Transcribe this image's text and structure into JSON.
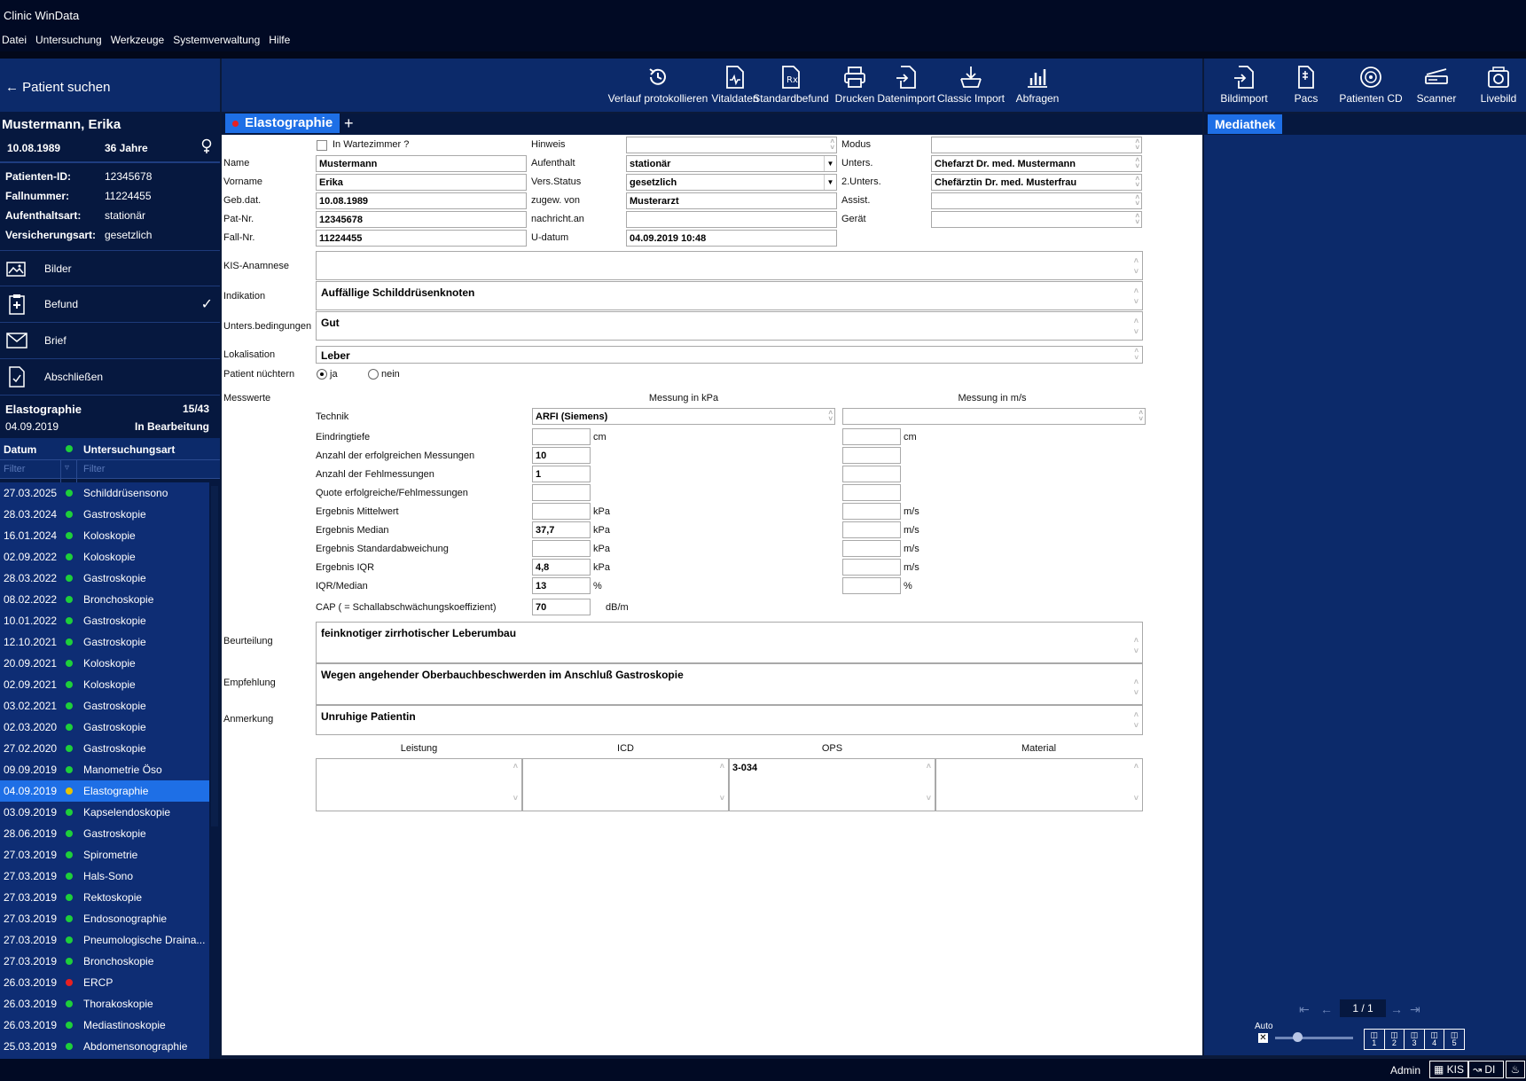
{
  "window": {
    "title": "Clinic WinData"
  },
  "menu": [
    "Datei",
    "Untersuchung",
    "Werkzeuge",
    "Systemverwaltung",
    "Hilfe"
  ],
  "left": {
    "back_label": "Patient suchen",
    "patient": {
      "name": "Mustermann, Erika",
      "dob": "10.08.1989",
      "age": "36 Jahre",
      "gender_icon": "female-icon",
      "fields": [
        {
          "label": "Patienten-ID:",
          "value": "12345678"
        },
        {
          "label": "Fallnummer:",
          "value": "11224455"
        },
        {
          "label": "Aufenthaltsart:",
          "value": "stationär"
        },
        {
          "label": "Versicherungsart:",
          "value": "gesetzlich"
        }
      ]
    },
    "nav": [
      {
        "label": "Bilder",
        "icon": "images-icon"
      },
      {
        "label": "Befund",
        "icon": "clipboard-icon",
        "checked": true
      },
      {
        "label": "Brief",
        "icon": "envelope-icon"
      },
      {
        "label": "Abschließen",
        "icon": "document-check-icon"
      }
    ],
    "exam": {
      "name": "Elastographie",
      "count": "15/43",
      "date": "04.09.2019",
      "status": "In Bearbeitung"
    },
    "history_headers": {
      "date": "Datum",
      "type": "Untersuchungsart",
      "filter": "Filter"
    },
    "history": [
      {
        "date": "27.03.2025",
        "type": "Schilddrüsensono",
        "status": "green"
      },
      {
        "date": "28.03.2024",
        "type": "Gastroskopie",
        "status": "green"
      },
      {
        "date": "16.01.2024",
        "type": "Koloskopie",
        "status": "green"
      },
      {
        "date": "02.09.2022",
        "type": "Koloskopie",
        "status": "green"
      },
      {
        "date": "28.03.2022",
        "type": "Gastroskopie",
        "status": "green"
      },
      {
        "date": "08.02.2022",
        "type": "Bronchoskopie",
        "status": "green"
      },
      {
        "date": "10.01.2022",
        "type": "Gastroskopie",
        "status": "green"
      },
      {
        "date": "12.10.2021",
        "type": "Gastroskopie",
        "status": "green"
      },
      {
        "date": "20.09.2021",
        "type": "Koloskopie",
        "status": "green"
      },
      {
        "date": "02.09.2021",
        "type": "Koloskopie",
        "status": "green"
      },
      {
        "date": "03.02.2021",
        "type": "Gastroskopie",
        "status": "green"
      },
      {
        "date": "02.03.2020",
        "type": "Gastroskopie",
        "status": "green"
      },
      {
        "date": "27.02.2020",
        "type": "Gastroskopie",
        "status": "green"
      },
      {
        "date": "09.09.2019",
        "type": "Manometrie Öso",
        "status": "green"
      },
      {
        "date": "04.09.2019",
        "type": "Elastographie",
        "status": "yellow",
        "selected": true
      },
      {
        "date": "03.09.2019",
        "type": "Kapselendoskopie",
        "status": "green"
      },
      {
        "date": "28.06.2019",
        "type": "Gastroskopie",
        "status": "green"
      },
      {
        "date": "27.03.2019",
        "type": "Spirometrie",
        "status": "green"
      },
      {
        "date": "27.03.2019",
        "type": "Hals-Sono",
        "status": "green"
      },
      {
        "date": "27.03.2019",
        "type": "Rektoskopie",
        "status": "green"
      },
      {
        "date": "27.03.2019",
        "type": "Endosonographie",
        "status": "green"
      },
      {
        "date": "27.03.2019",
        "type": "Pneumologische Draina...",
        "status": "green"
      },
      {
        "date": "27.03.2019",
        "type": "Bronchoskopie",
        "status": "green"
      },
      {
        "date": "26.03.2019",
        "type": "ERCP",
        "status": "red"
      },
      {
        "date": "26.03.2019",
        "type": "Thorakoskopie",
        "status": "green"
      },
      {
        "date": "26.03.2019",
        "type": "Mediastinoskopie",
        "status": "green"
      },
      {
        "date": "25.03.2019",
        "type": "Abdomensonographie",
        "status": "green"
      }
    ]
  },
  "toolbar": [
    {
      "label": "Verlauf protokollieren",
      "icon": "history-icon"
    },
    {
      "label": "Vitaldaten",
      "icon": "vitals-icon"
    },
    {
      "label": "Standardbefund",
      "icon": "prescription-icon"
    },
    {
      "label": "Drucken",
      "icon": "printer-icon"
    },
    {
      "label": "Datenimport",
      "icon": "import-icon"
    },
    {
      "label": "Classic Import",
      "icon": "download-tray-icon"
    },
    {
      "label": "Abfragen",
      "icon": "bar-chart-icon"
    }
  ],
  "toolbar_right": [
    {
      "label": "Bildimport",
      "icon": "image-import-icon"
    },
    {
      "label": "Pacs",
      "icon": "pacs-icon"
    },
    {
      "label": "Patienten CD",
      "icon": "cd-icon"
    },
    {
      "label": "Scanner",
      "icon": "scanner-icon"
    },
    {
      "label": "Livebild",
      "icon": "camera-icon"
    }
  ],
  "tab": {
    "label": "Elastographie",
    "add": "+"
  },
  "form": {
    "wartezimmer": "In Wartezimmer ?",
    "name_label": "Name",
    "name": "Mustermann",
    "vorname_label": "Vorname",
    "vorname": "Erika",
    "gebdat_label": "Geb.dat.",
    "gebdat": "10.08.1989",
    "patnr_label": "Pat-Nr.",
    "patnr": "12345678",
    "fallnr_label": "Fall-Nr.",
    "fallnr": "11224455",
    "hinweis_label": "Hinweis",
    "hinweis": "",
    "aufenthalt_label": "Aufenthalt",
    "aufenthalt": "stationär",
    "versstatus_label": "Vers.Status",
    "versstatus": "gesetzlich",
    "zugew_label": "zugew. von",
    "zugew": "Musterarzt",
    "nachricht_label": "nachricht.an",
    "nachricht": "",
    "udatum_label": "U-datum",
    "udatum": "04.09.2019 10:48",
    "modus_label": "Modus",
    "modus": "",
    "unters_label": "Unters.",
    "unters": "Chefarzt Dr. med. Mustermann",
    "unters2_label": "2.Unters.",
    "unters2": "Chefärztin Dr. med. Musterfrau",
    "assist_label": "Assist.",
    "assist": "",
    "geraet_label": "Gerät",
    "geraet": "",
    "kis_label": "KIS-Anamnese",
    "kis": "",
    "indikation_label": "Indikation",
    "indikation": "Auffällige Schilddrüsenknoten",
    "bedingungen_label": "Unters.bedingungen",
    "bedingungen": "Gut",
    "lokalisation_label": "Lokalisation",
    "lokalisation": "Leber",
    "nuechtern_label": "Patient nüchtern",
    "ja": "ja",
    "nein": "nein",
    "messwerte_label": "Messwerte",
    "hdr_kpa": "Messung in kPa",
    "hdr_ms": "Messung in m/s",
    "technik_label": "Technik",
    "technik": "ARFI (Siemens)",
    "rows": [
      {
        "label": "Eindringtiefe",
        "kpa": "",
        "unit1": "cm",
        "ms": "",
        "unit2": "cm"
      },
      {
        "label": "Anzahl der erfolgreichen Messungen",
        "kpa": "10",
        "unit1": "",
        "ms": "",
        "unit2": ""
      },
      {
        "label": "Anzahl der Fehlmessungen",
        "kpa": "1",
        "unit1": "",
        "ms": "",
        "unit2": ""
      },
      {
        "label": "Quote erfolgreiche/Fehlmessungen",
        "kpa": "",
        "unit1": "",
        "ms": "",
        "unit2": ""
      },
      {
        "label": "Ergebnis Mittelwert",
        "kpa": "",
        "unit1": "kPa",
        "ms": "",
        "unit2": "m/s"
      },
      {
        "label": "Ergebnis Median",
        "kpa": "37,7",
        "unit1": "kPa",
        "ms": "",
        "unit2": "m/s"
      },
      {
        "label": "Ergebnis Standardabweichung",
        "kpa": "",
        "unit1": "kPa",
        "ms": "",
        "unit2": "m/s"
      },
      {
        "label": "Ergebnis IQR",
        "kpa": "4,8",
        "unit1": "kPa",
        "ms": "",
        "unit2": "m/s"
      },
      {
        "label": "IQR/Median",
        "kpa": "13",
        "unit1": "%",
        "ms": "",
        "unit2": "%"
      }
    ],
    "cap_label": "CAP ( = Schallabschwächungskoeffizient)",
    "cap": "70",
    "cap_unit": "dB/m",
    "beurteilung_label": "Beurteilung",
    "beurteilung": "feinknotiger zirrhotischer Leberumbau",
    "empfehlung_label": "Empfehlung",
    "empfehlung": "Wegen angehender Oberbauchbeschwerden im Anschluß Gastroskopie",
    "anmerkung_label": "Anmerkung",
    "anmerkung": "Unruhige Patientin",
    "leistung_label": "Leistung",
    "icd_label": "ICD",
    "ops_label": "OPS",
    "material_label": "Material",
    "leistung": "",
    "icd": "",
    "ops": "3-034",
    "material": ""
  },
  "media": {
    "tab": "Mediathek",
    "pager": "1 / 1",
    "auto": "Auto",
    "layouts": [
      "1",
      "2",
      "3",
      "4",
      "5"
    ]
  },
  "status": {
    "user": "Admin",
    "kis": "KIS",
    "di": "DI"
  }
}
